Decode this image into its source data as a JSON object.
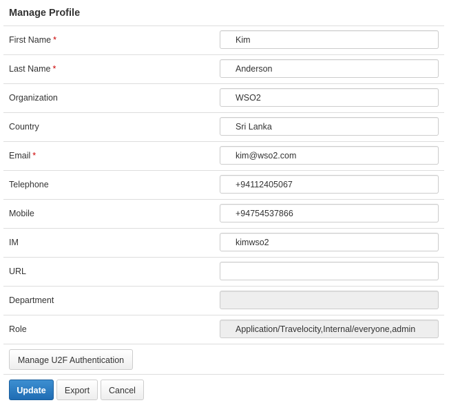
{
  "page": {
    "title": "Manage Profile"
  },
  "form": {
    "fields": [
      {
        "label": "First Name",
        "required": true,
        "value": "Kim",
        "readonly": false
      },
      {
        "label": "Last Name",
        "required": true,
        "value": "Anderson",
        "readonly": false
      },
      {
        "label": "Organization",
        "required": false,
        "value": "WSO2",
        "readonly": false
      },
      {
        "label": "Country",
        "required": false,
        "value": "Sri Lanka",
        "readonly": false
      },
      {
        "label": "Email",
        "required": true,
        "value": "kim@wso2.com",
        "readonly": false
      },
      {
        "label": "Telephone",
        "required": false,
        "value": "+94112405067",
        "readonly": false
      },
      {
        "label": "Mobile",
        "required": false,
        "value": "+94754537866",
        "readonly": false
      },
      {
        "label": "IM",
        "required": false,
        "value": "kimwso2",
        "readonly": false
      },
      {
        "label": "URL",
        "required": false,
        "value": "",
        "readonly": false
      },
      {
        "label": "Department",
        "required": false,
        "value": "",
        "readonly": true
      },
      {
        "label": "Role",
        "required": false,
        "value": "Application/Travelocity,Internal/everyone,admin",
        "readonly": true
      }
    ],
    "required_marker": "*"
  },
  "u2f": {
    "button_label": "Manage U2F Authentication"
  },
  "actions": {
    "update_label": "Update",
    "export_label": "Export",
    "cancel_label": "Cancel"
  },
  "colors": {
    "primary_button": "#2a7bc2",
    "required_marker": "#cc0000",
    "readonly_field": "#eeeeee"
  }
}
